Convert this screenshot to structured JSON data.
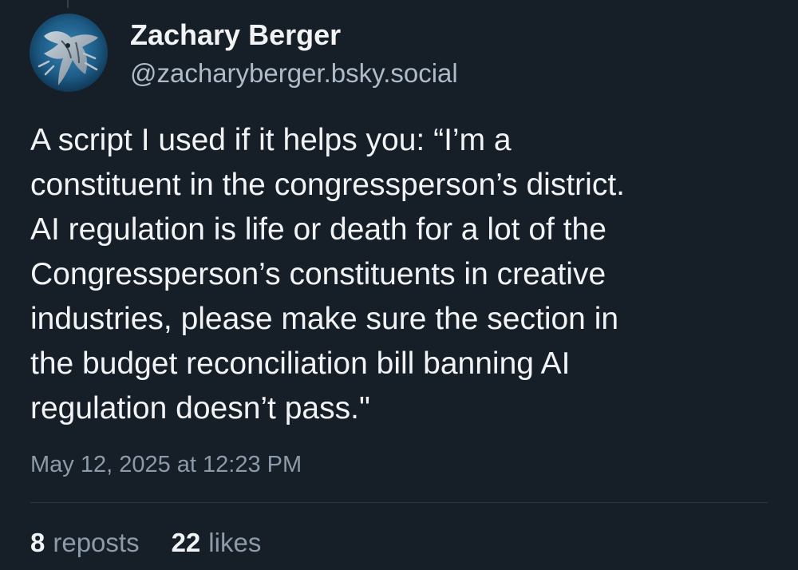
{
  "post": {
    "author": {
      "display_name": "Zachary Berger",
      "handle": "@zacharyberger.bsky.social",
      "avatar_icon": "sea-creature-avatar-icon"
    },
    "text": "A script I used if it helps you: “I’m a\nconstituent in the congressperson’s district.\nAI regulation is life or death for a lot of the\nCongressperson’s constituents in creative\nindustries, please make sure the section in\nthe budget reconciliation bill banning AI\nregulation doesn’t pass.\"",
    "timestamp": "May 12, 2025 at 12:23 PM",
    "stats": {
      "reposts_count": "8",
      "reposts_label": "reposts",
      "likes_count": "22",
      "likes_label": "likes"
    }
  },
  "colors": {
    "background": "#161e27",
    "text_primary": "#f1f3f5",
    "text_secondary": "#8c9aaa",
    "handle": "#aebbc9",
    "divider": "#2a3644"
  }
}
